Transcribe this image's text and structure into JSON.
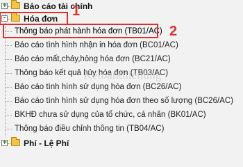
{
  "tree": {
    "parents": [
      {
        "label": "Báo cáo tài chính",
        "expander": "+",
        "icon": "folder-icon"
      },
      {
        "label": "Hóa đơn",
        "expander": "-",
        "icon": "folder-icon"
      },
      {
        "label": "Phí - Lệ Phí",
        "expander": "+",
        "icon": "folder-icon"
      }
    ],
    "children": [
      {
        "label": "Thông báo phát hành hóa đơn (TB01/AC)"
      },
      {
        "label": "Báo cáo tình hình nhận in hóa đơn (BC01/AC)"
      },
      {
        "label": "Báo cáo mất,cháy,hỏng hóa đơn (BC21/AC)"
      },
      {
        "label": "Thông báo kết quả hủy hóa đơn (TB03/AC)"
      },
      {
        "label": "Báo cáo tình hình sử dụng hóa đơn (BC26/AC)"
      },
      {
        "label": "Báo cáo tình hình sử dụng hóa đơn theo số lượng (BC26/AC)"
      },
      {
        "label": "BKHĐ chưa sử dụng của tổ chức, cá nhân (BK01/AC)"
      },
      {
        "label": "Thông báo điều chỉnh thông tin (TB04/AC)"
      }
    ]
  },
  "annotations": {
    "marker_1": "1",
    "marker_2": "2",
    "color": "#e0302a"
  },
  "watermark": "Ketoanthienung"
}
